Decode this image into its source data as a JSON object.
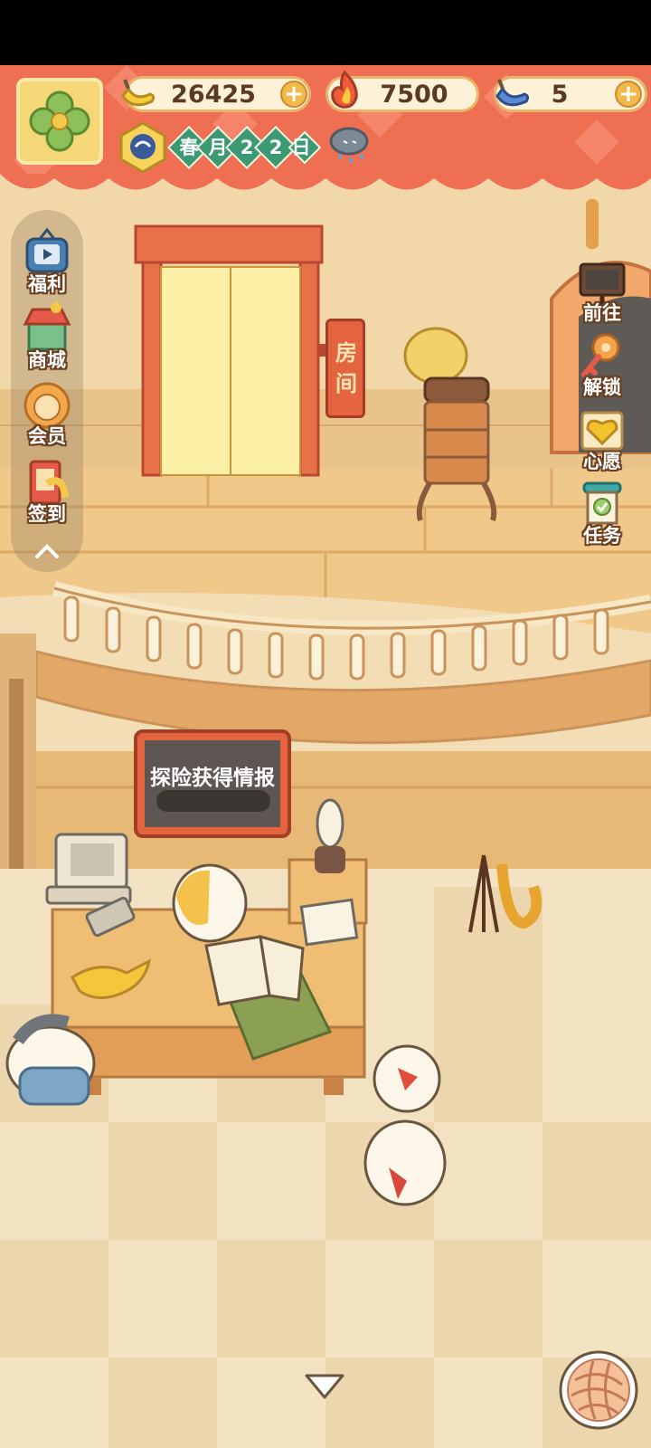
{
  "currencies": {
    "banana": {
      "value": "26425",
      "icon": "banana-icon"
    },
    "flame": {
      "value": "7500",
      "icon": "flame-icon"
    },
    "blue_banana": {
      "value": "5",
      "icon": "blue-banana-icon"
    }
  },
  "date": {
    "season": "春",
    "month_label": "月",
    "day_tens": "2",
    "day_ones": "2",
    "day_label": "日"
  },
  "weather": {
    "icon": "rain-cloud-icon"
  },
  "left_menu": {
    "welfare": "福利",
    "shop": "商城",
    "member": "会员",
    "checkin": "签到"
  },
  "right_menu": {
    "goto": "前往",
    "unlock": "解锁",
    "wish": "心愿",
    "task": "任务"
  },
  "room_sign": {
    "line1": "房",
    "line2": "间"
  },
  "info_board": {
    "title": "探险获得情报"
  },
  "colors": {
    "banner": "#ef6f52",
    "floor": "#f3ddb4",
    "accent_green": "#3b9a72"
  }
}
